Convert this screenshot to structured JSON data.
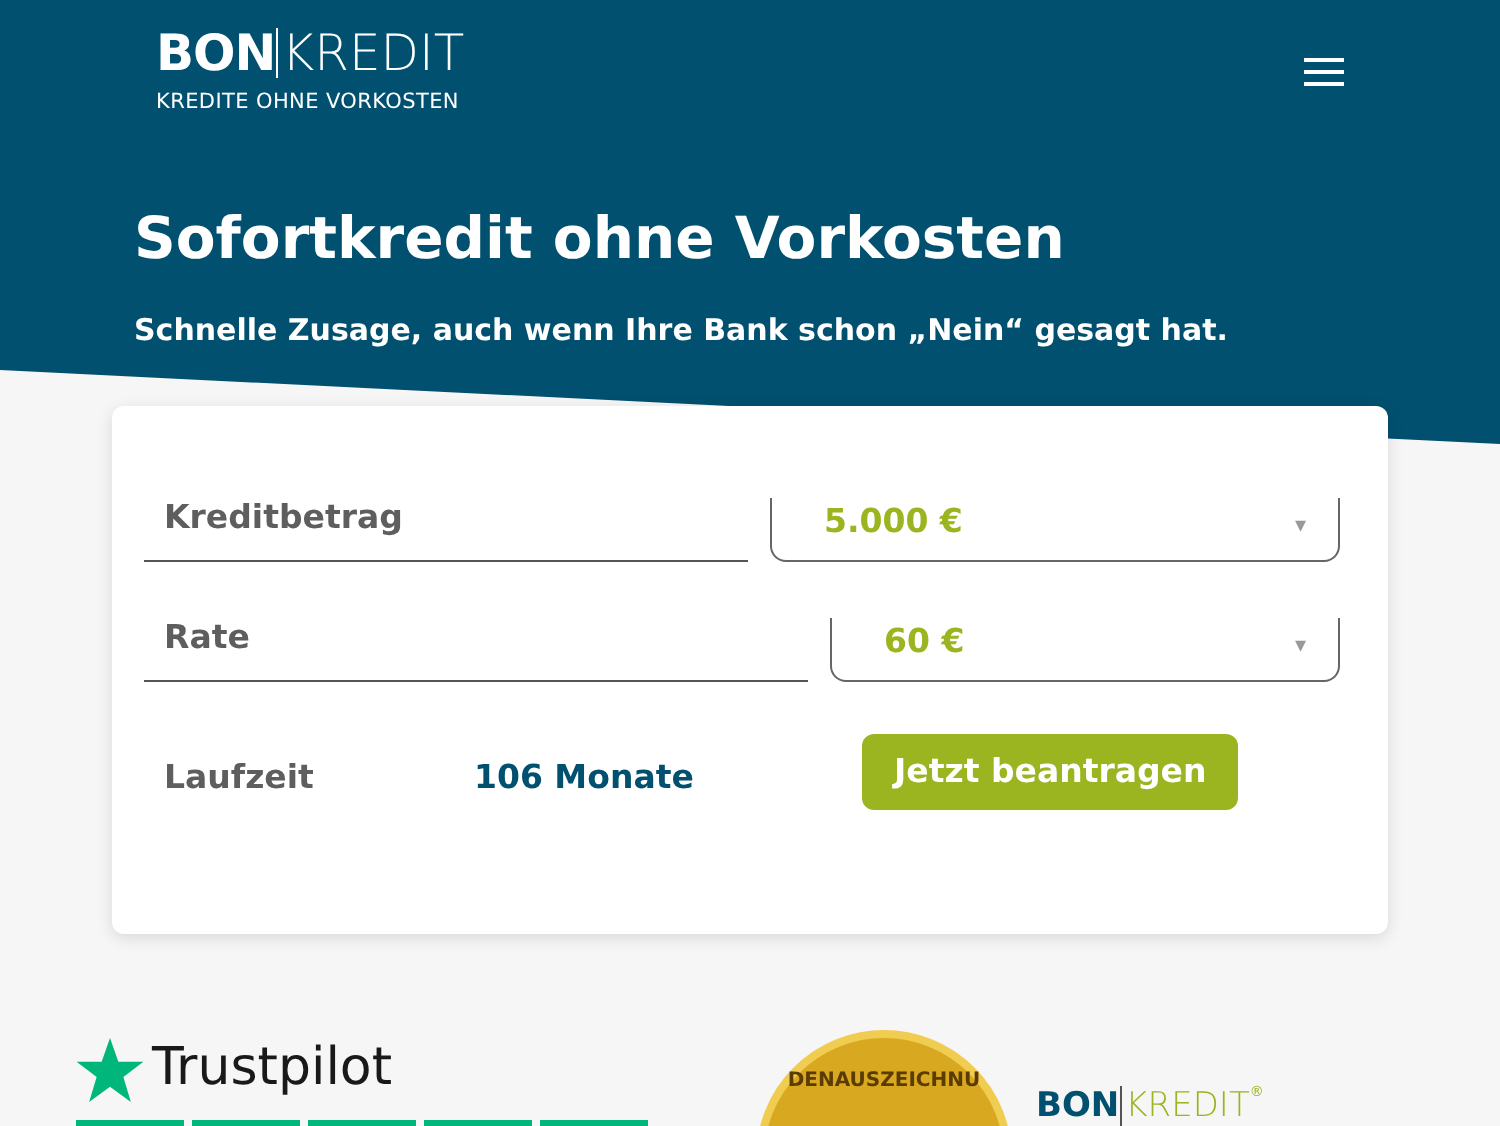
{
  "header": {
    "logo": {
      "part_1": "BON",
      "part_2": "KREDIT",
      "tagline": "KREDITE OHNE VORKOSTEN"
    },
    "title": "Sofortkredit ohne Vorkosten",
    "subtitle": "Schnelle Zusage, auch wenn Ihre Bank schon „Nein“ gesagt hat."
  },
  "calculator": {
    "fields": [
      {
        "label": "Kreditbetrag",
        "value": "5.000 €",
        "caret": "▾"
      },
      {
        "label": "Rate",
        "value": "60 €",
        "caret": "▾"
      }
    ],
    "term": {
      "label": "Laufzeit",
      "value": "106 Monate"
    },
    "button": "Jetzt beantragen"
  },
  "trust": {
    "trustpilot": "Trustpilot",
    "seal_text": "DENAUSZEICHNU",
    "brand": {
      "part_1": "BON",
      "part_2": "KREDIT",
      "mark": "®"
    }
  }
}
